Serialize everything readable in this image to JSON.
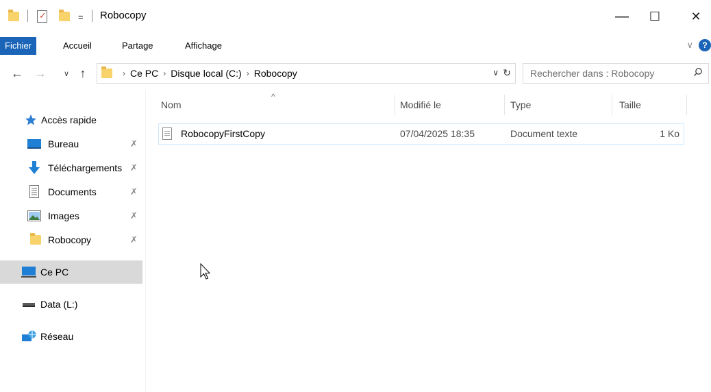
{
  "window": {
    "title": "Robocopy",
    "quick_access_dropdown": "=",
    "controls": {
      "minimize": "—",
      "maximize": "☐",
      "close": "✕"
    }
  },
  "ribbon": {
    "tabs": [
      {
        "label": "Fichier",
        "active": true
      },
      {
        "label": "Accueil"
      },
      {
        "label": "Partage"
      },
      {
        "label": "Affichage"
      }
    ],
    "expand_glyph": "∨",
    "help_glyph": "?"
  },
  "nav": {
    "back": "←",
    "forward": "→",
    "recent": "∨",
    "up": "↑",
    "breadcrumb": [
      "Ce PC",
      "Disque local (C:)",
      "Robocopy"
    ],
    "separator": "›",
    "dropdown_glyph": "∨",
    "refresh_glyph": "↻",
    "search_placeholder": "Rechercher dans : Robocopy"
  },
  "sidebar": {
    "quick_access_label": "Accès rapide",
    "pinned": [
      {
        "label": "Bureau",
        "icon": "desktop-icon"
      },
      {
        "label": "Téléchargements",
        "icon": "download-icon"
      },
      {
        "label": "Documents",
        "icon": "documents-icon"
      },
      {
        "label": "Images",
        "icon": "images-icon"
      },
      {
        "label": "Robocopy",
        "icon": "folder-icon"
      }
    ],
    "pin_glyph": "✗",
    "this_pc": "Ce PC",
    "drive": "Data (L:)",
    "network": "Réseau"
  },
  "columns": {
    "name": "Nom",
    "modified": "Modifié le",
    "type": "Type",
    "size": "Taille",
    "sort_glyph": "^"
  },
  "files": [
    {
      "name": "RobocopyFirstCopy",
      "modified": "07/04/2025 18:35",
      "type": "Document texte",
      "size": "1 Ko"
    }
  ],
  "colors": {
    "accent": "#1a65b8",
    "folder": "#f8d26b",
    "selection_border": "#cce8ff",
    "sidebar_selected": "#d9d9d9"
  }
}
